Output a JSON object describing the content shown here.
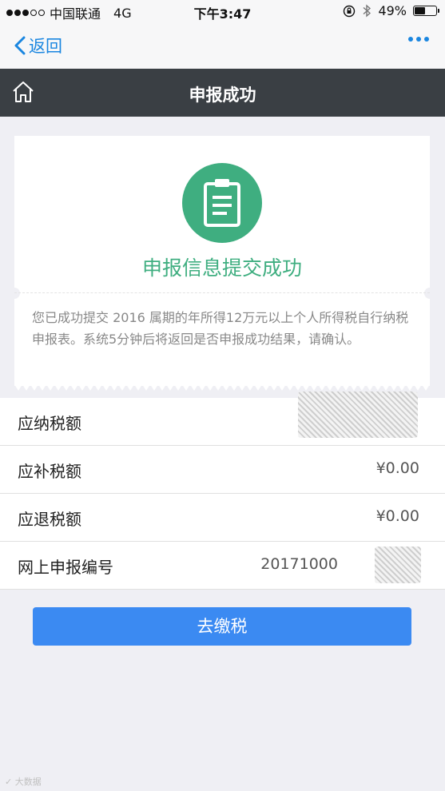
{
  "status_bar": {
    "carrier": "中国联通",
    "network": "4G",
    "time": "下午3:47",
    "battery": "49%",
    "battery_level": 0.49
  },
  "nav": {
    "back_label": "返回"
  },
  "header": {
    "title": "申报成功"
  },
  "card": {
    "headline": "申报信息提交成功",
    "description": "您已成功提交 2016 属期的年所得12万元以上个人所得税自行纳税申报表。系统5分钟后将返回是否申报成功结果，请确认。"
  },
  "rows": [
    {
      "label": "应纳税额",
      "value": ""
    },
    {
      "label": "应补税额",
      "value": "¥0.00"
    },
    {
      "label": "应退税额",
      "value": "¥0.00"
    },
    {
      "label": "网上申报编号",
      "value": "20171000"
    }
  ],
  "pay_button": "去缴税",
  "colors": {
    "accent": "#1a86e0",
    "success": "#3fae80",
    "button": "#3b8af2",
    "header_bg": "#3a3f44"
  }
}
